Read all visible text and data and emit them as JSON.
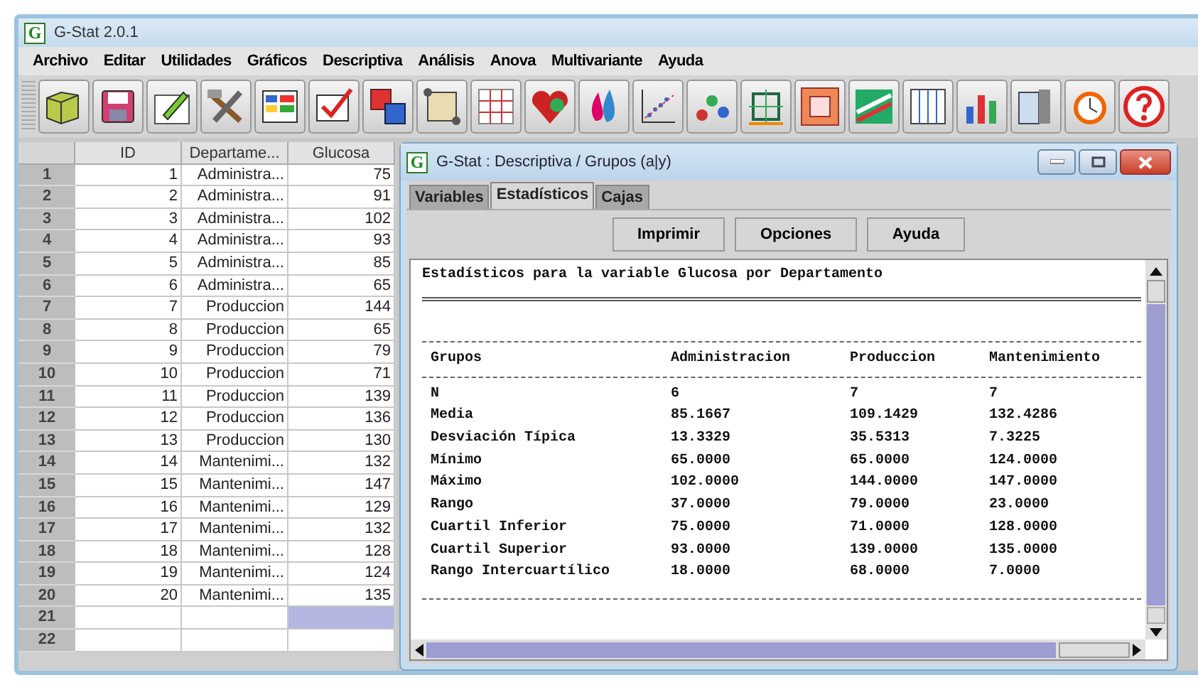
{
  "window": {
    "title": "G-Stat 2.0.1",
    "logo": "G"
  },
  "menu": [
    "Archivo",
    "Editar",
    "Utilidades",
    "Gráficos",
    "Descriptiva",
    "Análisis",
    "Anova",
    "Multivariante",
    "Ayuda"
  ],
  "sheet": {
    "columns": [
      "ID",
      "Departame...",
      "Glucosa"
    ],
    "rows": [
      {
        "header": "1",
        "id": "1",
        "department": "Administra...",
        "glucosa": "75",
        "glucosa_selected": false
      },
      {
        "header": "2",
        "id": "2",
        "department": "Administra...",
        "glucosa": "91",
        "glucosa_selected": false
      },
      {
        "header": "3",
        "id": "3",
        "department": "Administra...",
        "glucosa": "102",
        "glucosa_selected": false
      },
      {
        "header": "4",
        "id": "4",
        "department": "Administra...",
        "glucosa": "93",
        "glucosa_selected": false
      },
      {
        "header": "5",
        "id": "5",
        "department": "Administra...",
        "glucosa": "85",
        "glucosa_selected": false
      },
      {
        "header": "6",
        "id": "6",
        "department": "Administra...",
        "glucosa": "65",
        "glucosa_selected": false
      },
      {
        "header": "7",
        "id": "7",
        "department": "Produccion",
        "glucosa": "144",
        "glucosa_selected": false
      },
      {
        "header": "8",
        "id": "8",
        "department": "Produccion",
        "glucosa": "65",
        "glucosa_selected": false
      },
      {
        "header": "9",
        "id": "9",
        "department": "Produccion",
        "glucosa": "79",
        "glucosa_selected": false
      },
      {
        "header": "10",
        "id": "10",
        "department": "Produccion",
        "glucosa": "71",
        "glucosa_selected": false
      },
      {
        "header": "11",
        "id": "11",
        "department": "Produccion",
        "glucosa": "139",
        "glucosa_selected": false
      },
      {
        "header": "12",
        "id": "12",
        "department": "Produccion",
        "glucosa": "136",
        "glucosa_selected": false
      },
      {
        "header": "13",
        "id": "13",
        "department": "Produccion",
        "glucosa": "130",
        "glucosa_selected": false
      },
      {
        "header": "14",
        "id": "14",
        "department": "Mantenimi...",
        "glucosa": "132",
        "glucosa_selected": false
      },
      {
        "header": "15",
        "id": "15",
        "department": "Mantenimi...",
        "glucosa": "147",
        "glucosa_selected": false
      },
      {
        "header": "16",
        "id": "16",
        "department": "Mantenimi...",
        "glucosa": "129",
        "glucosa_selected": false
      },
      {
        "header": "17",
        "id": "17",
        "department": "Mantenimi...",
        "glucosa": "132",
        "glucosa_selected": false
      },
      {
        "header": "18",
        "id": "18",
        "department": "Mantenimi...",
        "glucosa": "128",
        "glucosa_selected": false
      },
      {
        "header": "19",
        "id": "19",
        "department": "Mantenimi...",
        "glucosa": "124",
        "glucosa_selected": false
      },
      {
        "header": "20",
        "id": "20",
        "department": "Mantenimi...",
        "glucosa": "135",
        "glucosa_selected": false
      },
      {
        "header": "21",
        "id": "",
        "department": "",
        "glucosa": "",
        "glucosa_selected": true
      },
      {
        "header": "22",
        "id": "",
        "department": "",
        "glucosa": "",
        "glucosa_selected": false
      }
    ]
  },
  "dialog": {
    "title": "G-Stat : Descriptiva / Grupos (a|y)",
    "logo": "G",
    "tabs": [
      {
        "label": "Variables",
        "selected": false
      },
      {
        "label": "Estadísticos",
        "selected": true
      },
      {
        "label": "Cajas",
        "selected": false
      }
    ],
    "buttons": [
      "Imprimir",
      "Opciones",
      "Ayuda"
    ],
    "report": {
      "heading": "Estadísticos para la variable Glucosa por Departamento",
      "columns": [
        "Grupos",
        "Administracion",
        "Produccion",
        "Mantenimiento"
      ],
      "rows": [
        [
          "N",
          "6",
          "7",
          "7"
        ],
        [
          "Media",
          "85.1667",
          "109.1429",
          "132.4286"
        ],
        [
          "Desviación Típica",
          "13.3329",
          "35.5313",
          "7.3225"
        ],
        [
          "Mínimo",
          "65.0000",
          "65.0000",
          "124.0000"
        ],
        [
          "Máximo",
          "102.0000",
          "144.0000",
          "147.0000"
        ],
        [
          "Rango",
          "37.0000",
          "79.0000",
          "23.0000"
        ],
        [
          "Cuartil Inferior",
          "75.0000",
          "71.0000",
          "128.0000"
        ],
        [
          "Cuartil Superior",
          "93.0000",
          "139.0000",
          "135.0000"
        ],
        [
          "Rango Intercuartílico",
          "18.0000",
          "68.0000",
          "7.0000"
        ]
      ]
    }
  }
}
